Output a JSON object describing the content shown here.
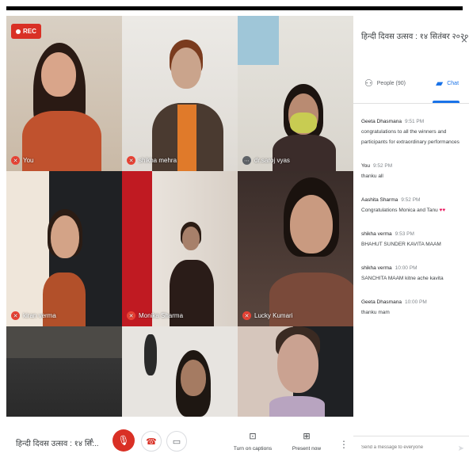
{
  "meeting": {
    "title": "हिन्दी दिवस उत्सव : १४ सि...",
    "recording_label": "REC"
  },
  "panel": {
    "title": "हिन्दी दिवस उत्सव : १४ सितंबर २०२०",
    "close_label": "×",
    "tabs": {
      "people": "People (90)",
      "chat": "Chat"
    },
    "composer_placeholder": "Send a message to everyone"
  },
  "messages": [
    {
      "sender": "Geeta Dhasmana",
      "time": "9:51 PM",
      "text": "congratulations to all the winners and participants for extraordinary performances"
    },
    {
      "sender": "You",
      "time": "9:52 PM",
      "text": "thanku all"
    },
    {
      "sender": "Aashita Sharma",
      "time": "9:52 PM",
      "text": "Congratulations Monica and Tanu",
      "emoji": "♥♥"
    },
    {
      "sender": "shikha verma",
      "time": "9:53 PM",
      "text": "BHAHUT SUNDER KAVITA MAAM"
    },
    {
      "sender": "shikha verma",
      "time": "10:00 PM",
      "text": "SANCHITA MAAM kitne ache kavita"
    },
    {
      "sender": "Geeta Dhasmana",
      "time": "10:00 PM",
      "text": "thanku mam"
    }
  ],
  "participants": [
    {
      "name": "You"
    },
    {
      "name": "shikha mehra"
    },
    {
      "name": "dr.saroj vyas"
    },
    {
      "name": "kiran verma"
    },
    {
      "name": "Monika Sharma"
    },
    {
      "name": "Lucky Kumari"
    },
    {
      "name": ""
    },
    {
      "name": ""
    },
    {
      "name": ""
    }
  ],
  "controls": {
    "captions_label": "Turn on captions",
    "present_label": "Present now"
  },
  "colors": {
    "accent": "#1a73e8",
    "record_red": "#d93025",
    "muted_red": "#ea4335"
  }
}
